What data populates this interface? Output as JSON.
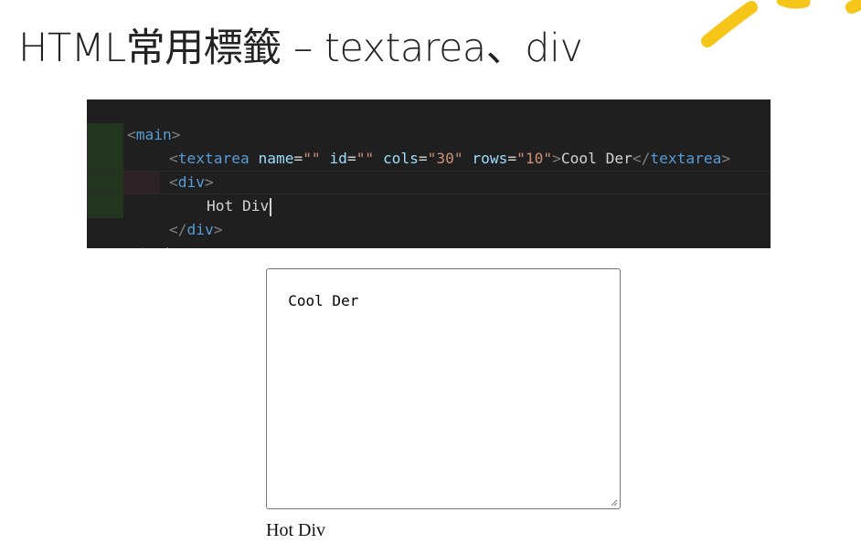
{
  "slide": {
    "title": "HTML常用標籤 – textarea、div"
  },
  "code": {
    "lines": [
      [
        "<",
        "main",
        ">"
      ],
      [
        "<",
        "textarea",
        "name",
        "=",
        "\"\"",
        "id",
        "=",
        "\"\"",
        "cols",
        "=",
        "\"30\"",
        "rows",
        "=",
        "\"10\"",
        ">",
        "Cool Der",
        "</",
        "textarea",
        ">"
      ],
      [
        "<",
        "div",
        ">"
      ],
      [
        "Hot Div"
      ],
      [
        "</",
        "div",
        ">"
      ],
      [
        "</",
        "main",
        ">"
      ]
    ]
  },
  "preview": {
    "textarea_value": "Cool Der",
    "div_text": "Hot Div"
  },
  "colors": {
    "accent_yellow": "#f5c518",
    "editor_bg": "#1f1f1f",
    "tag_blue": "#569cd6",
    "attr_lightblue": "#9cdcfe",
    "string_orange": "#ce9178",
    "punct_gray": "#808080"
  }
}
